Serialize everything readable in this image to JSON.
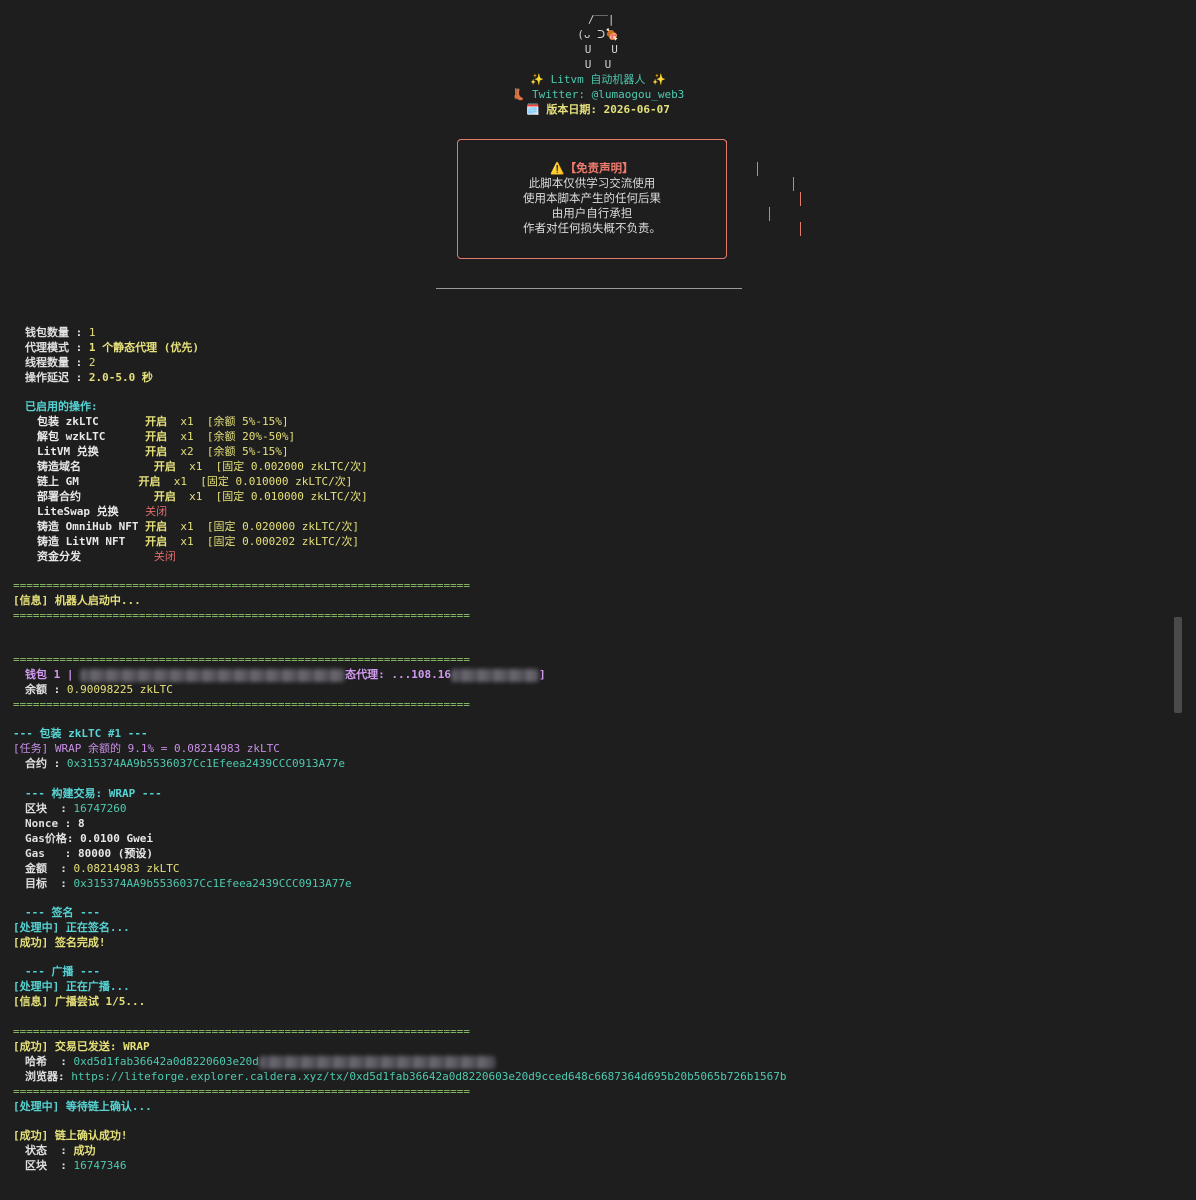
{
  "banner": {
    "art": [
      " /‾‾|",
      "(ᴗ ᑐ🍖",
      " U   U",
      "U  U"
    ],
    "title": "✨ Litvm 自动机器人 ✨",
    "twitter": "👢 Twitter: @lumaogou_web3",
    "version": "🗓️ 版本日期: 2026-06-07"
  },
  "disclaimer": {
    "title": "⚠️【免责声明】",
    "lines": [
      "此脚本仅供学习交流使用",
      "使用本脚本产生的任何后果",
      "由用户自行承担",
      "作者对任何损失概不负责。"
    ]
  },
  "config": [
    {
      "label": "钱包数量",
      "value": "1"
    },
    {
      "label": "代理模式",
      "value": "1 个静态代理 (优先)"
    },
    {
      "label": "线程数量",
      "value": "2"
    },
    {
      "label": "操作延迟",
      "value": "2.0-5.0 秒"
    }
  ],
  "ops_header": "已启用的操作:",
  "operations": [
    {
      "name": "包装 zkLTC",
      "pad": "       ",
      "status": "开启",
      "on": true,
      "detail": "  x1  [余额 5%-15%]"
    },
    {
      "name": "解包 wzkLTC",
      "pad": "      ",
      "status": "开启",
      "on": true,
      "detail": "  x1  [余额 20%-50%]"
    },
    {
      "name": "LitVM 兑换",
      "pad": "       ",
      "status": "开启",
      "on": true,
      "detail": "  x2  [余额 5%-15%]"
    },
    {
      "name": "铸造域名",
      "pad": "           ",
      "status": "开启",
      "on": true,
      "detail": "  x1  [固定 0.002000 zkLTC/次]"
    },
    {
      "name": "链上 GM",
      "pad": "         ",
      "status": "开启",
      "on": true,
      "detail": "  x1  [固定 0.010000 zkLTC/次]"
    },
    {
      "name": "部署合约",
      "pad": "           ",
      "status": "开启",
      "on": true,
      "detail": "  x1  [固定 0.010000 zkLTC/次]"
    },
    {
      "name": "LiteSwap 兑换",
      "pad": "    ",
      "status": "关闭",
      "on": false,
      "detail": ""
    },
    {
      "name": "铸造 OmniHub NFT",
      "pad": " ",
      "status": "开启",
      "on": true,
      "detail": "  x1  [固定 0.020000 zkLTC/次]"
    },
    {
      "name": "铸造 LitVM NFT",
      "pad": "   ",
      "status": "开启",
      "on": true,
      "detail": "  x1  [固定 0.000202 zkLTC/次]"
    },
    {
      "name": "资金分发",
      "pad": "           ",
      "status": "关闭",
      "on": false,
      "detail": ""
    }
  ],
  "sep": "=====================================================================",
  "start_msg": "[信息] 机器人启动中...",
  "wallet": {
    "prefix": "钱包 1 | ",
    "proxy_label": "态代理: ...108.16",
    "suffix": "]",
    "balance_label": "余额",
    "balance": "0.90098225 zkLTC"
  },
  "task": {
    "heading": "--- 包装 zkLTC #1 ---",
    "task_line": "[任务] WRAP 余额的 9.1% = 0.08214983 zkLTC",
    "contract_label": "合约",
    "contract": "0x315374AA9b5536037Cc1Efeea2439CCC0913A77e",
    "build_heading": "--- 构建交易: WRAP ---",
    "block_label": "区块",
    "block": "16747260",
    "nonce_label": "Nonce",
    "nonce": "8",
    "gasprice_label": "Gas价格",
    "gasprice": "0.0100 Gwei",
    "gas_label": "Gas",
    "gas": "80000 (预设)",
    "amount_label": "金额",
    "amount": "0.08214983 zkLTC",
    "target_label": "目标",
    "target": "0x315374AA9b5536037Cc1Efeea2439CCC0913A77e",
    "sign_heading": "--- 签名 ---",
    "signing": "[处理中] 正在签名...",
    "signed": "[成功] 签名完成!",
    "broadcast_heading": "--- 广播 ---",
    "broadcasting": "[处理中] 正在广播...",
    "attempt": "[信息] 广播尝试 1/5...",
    "sent": "[成功] 交易已发送: WRAP",
    "hash_label": "哈希",
    "hash": "0xd5d1fab36642a0d8220603e20d",
    "explorer_label": "浏览器",
    "explorer": "https://liteforge.explorer.caldera.xyz/tx/0xd5d1fab36642a0d8220603e20d9cced648c6687364d695b20b5065b726b1567b",
    "waiting": "[处理中] 等待链上确认...",
    "confirmed": "[成功] 链上确认成功!",
    "status_label": "状态",
    "status": "成功",
    "final_block_label": "区块",
    "final_block": "16747346"
  }
}
